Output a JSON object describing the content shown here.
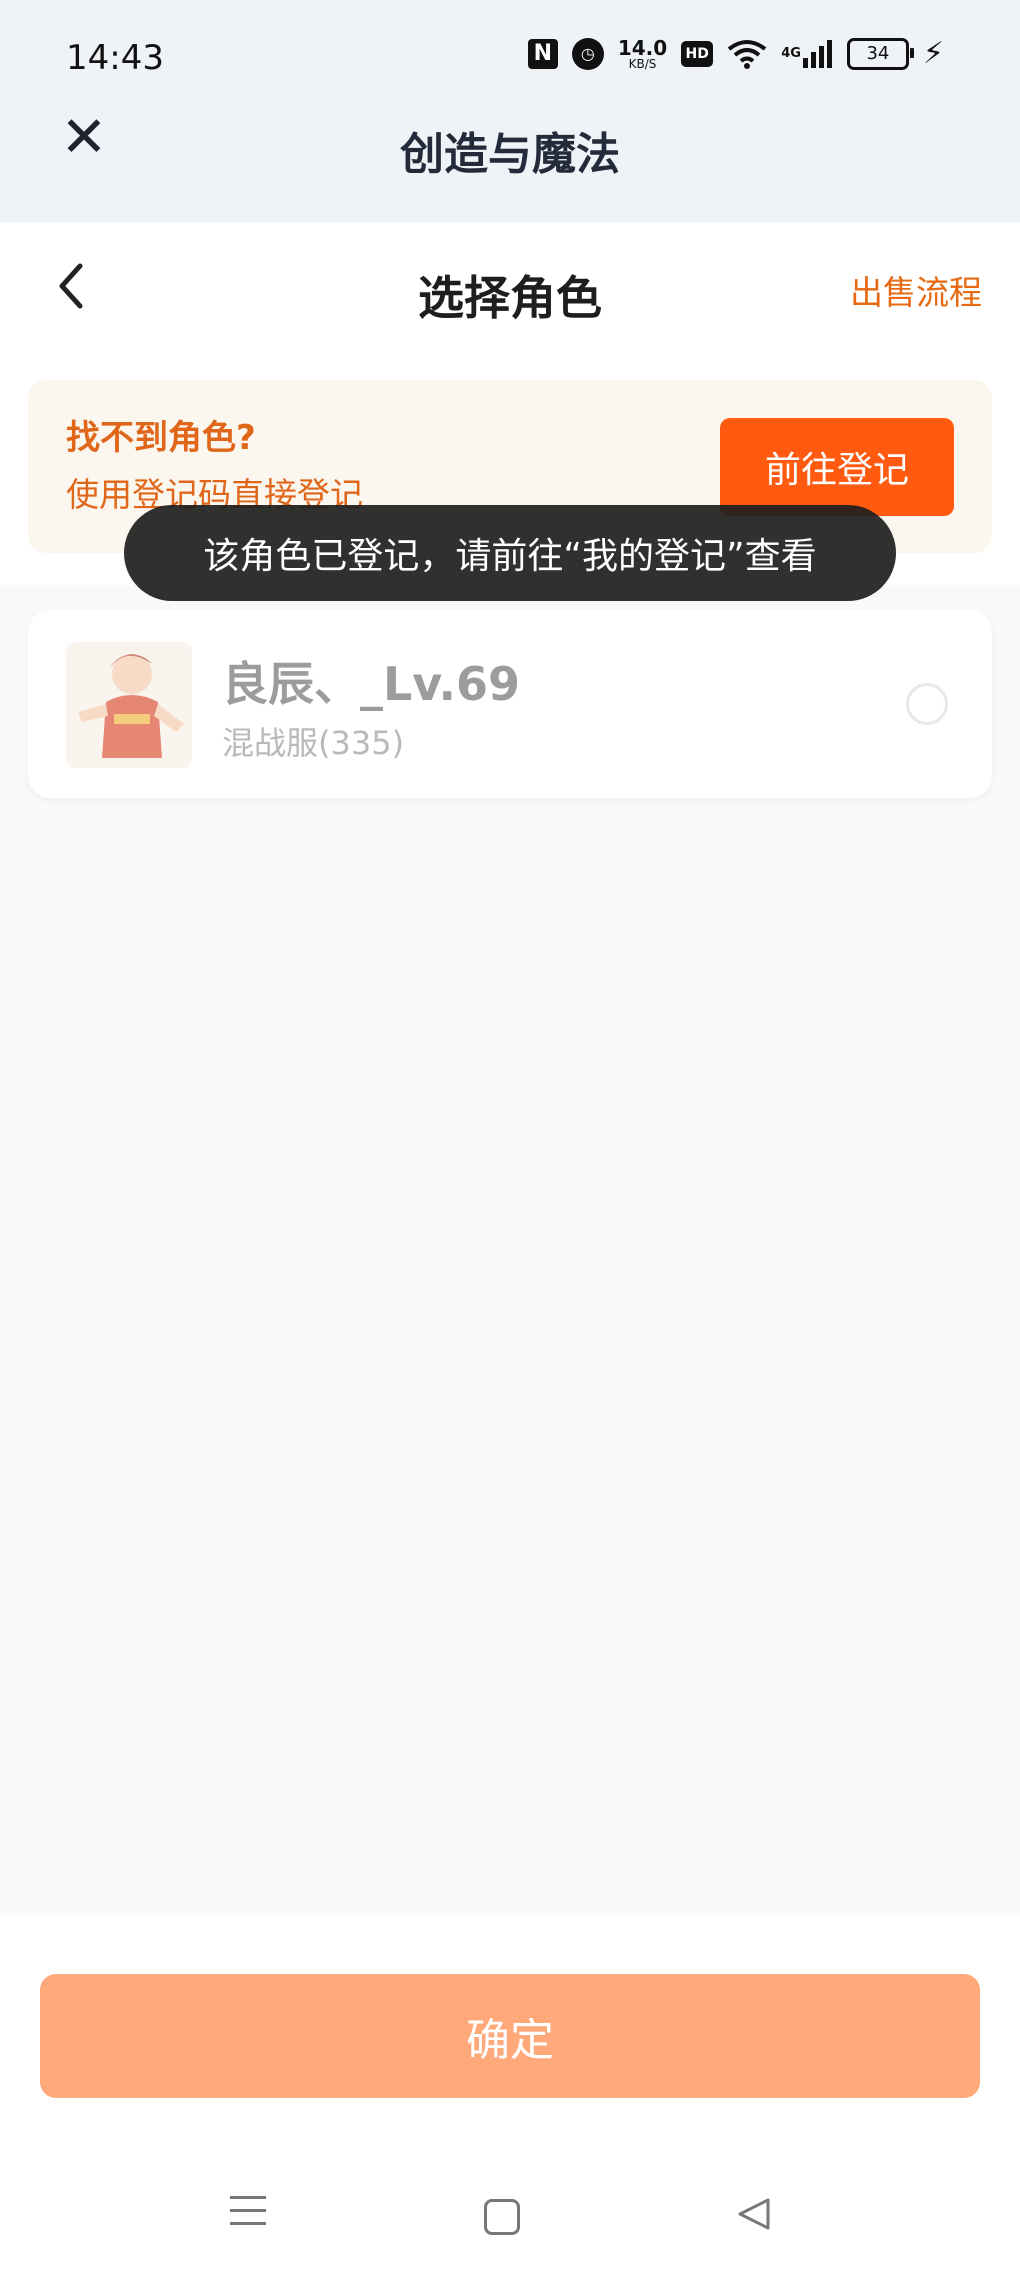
{
  "status_bar": {
    "time": "14:43",
    "nfc_label": "N",
    "speed_value": "14.0",
    "speed_unit": "KB/S",
    "hd_label": "HD",
    "network": "4G",
    "battery": "34"
  },
  "app_bar": {
    "close_icon": "close-icon",
    "title": "创造与魔法"
  },
  "page_header": {
    "back_icon": "chevron-left-icon",
    "title": "选择角色",
    "sale_link": "出售流程"
  },
  "banner": {
    "title": "找不到角色?",
    "subtitle": "使用登记码直接登记",
    "button_label": "前往登记"
  },
  "toast": {
    "message": "该角色已登记，请前往“我的登记”查看"
  },
  "roles": [
    {
      "name": "良辰、_Lv.69",
      "server": "混战服(335)",
      "selected": false
    }
  ],
  "footer": {
    "confirm_label": "确定"
  },
  "colors": {
    "accent": "#ff5a0f",
    "accent_text": "#e0661a",
    "confirm_disabled": "#ffa97a",
    "banner_bg": "#fbf6ee"
  }
}
